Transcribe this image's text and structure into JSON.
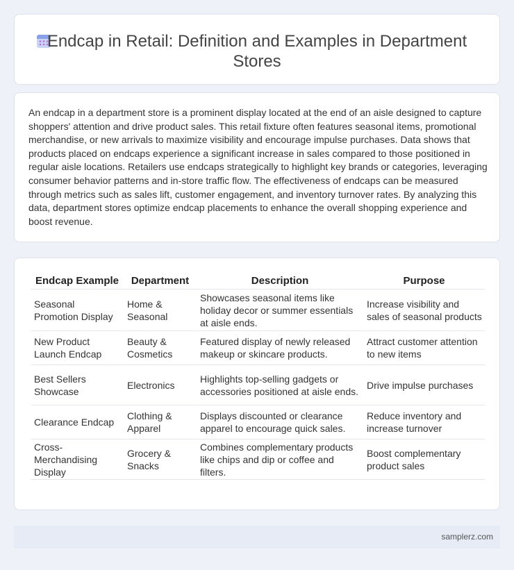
{
  "header": {
    "title": "Endcap in Retail: Definition and Examples in Department Stores",
    "icon": "calendar-icon"
  },
  "intro": {
    "text": "An endcap in a department store is a prominent display located at the end of an aisle designed to capture shoppers' attention and drive product sales. This retail fixture often features seasonal items, promotional merchandise, or new arrivals to maximize visibility and encourage impulse purchases. Data shows that products placed on endcaps experience a significant increase in sales compared to those positioned in regular aisle locations. Retailers use endcaps strategically to highlight key brands or categories, leveraging consumer behavior patterns and in-store traffic flow. The effectiveness of endcaps can be measured through metrics such as sales lift, customer engagement, and inventory turnover rates. By analyzing this data, department stores optimize endcap placements to enhance the overall shopping experience and boost revenue."
  },
  "table": {
    "headers": [
      "Endcap Example",
      "Department",
      "Description",
      "Purpose"
    ],
    "rows": [
      [
        "Seasonal Promotion Display",
        "Home & Seasonal",
        "Showcases seasonal items like holiday decor or summer essentials at aisle ends.",
        "Increase visibility and sales of seasonal products"
      ],
      [
        "New Product Launch Endcap",
        "Beauty & Cosmetics",
        "Featured display of newly released makeup or skincare products.",
        "Attract customer attention to new items"
      ],
      [
        "Best Sellers Showcase",
        "Electronics",
        "Highlights top-selling gadgets or accessories positioned at aisle ends.",
        "Drive impulse purchases"
      ],
      [
        "Clearance Endcap",
        "Clothing & Apparel",
        "Displays discounted or clearance apparel to encourage quick sales.",
        "Reduce inventory and increase turnover"
      ],
      [
        "Cross-Merchandising Display",
        "Grocery & Snacks",
        "Combines complementary products like chips and dip or coffee and filters.",
        "Boost complementary product sales"
      ]
    ]
  },
  "footer": {
    "text": "samplerz.com"
  }
}
